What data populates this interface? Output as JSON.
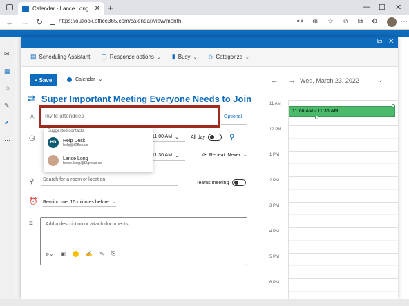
{
  "browser": {
    "tab_title": "Calendar - Lance Long - Outlook",
    "tab_close": "✕",
    "new_tab": "+",
    "url": "https://outlook.office365.com/calendar/view/month"
  },
  "toolbar": {
    "scheduling_assistant": "Scheduling Assistant",
    "response_options": "Response options",
    "busy": "Busy",
    "categorize": "Categorize",
    "more": "···"
  },
  "form": {
    "save_label": "Save",
    "calendar_label": "Calendar",
    "title": "Super Important Meeting Everyone Needs to Join",
    "attendees_placeholder": "Invite attendees",
    "optional_label": "Optional",
    "start_time": "11:00 AM",
    "end_time": "11:30 AM",
    "all_day_label": "All day",
    "repeat_label": "Repeat: Never",
    "location_placeholder": "Search for a room or location",
    "teams_label": "Teams meeting",
    "reminder_label": "Remind me: 15 minutes before",
    "description_placeholder": "Add a description or attach documents"
  },
  "suggestions": {
    "heading": "Suggested contacts",
    "contacts": [
      {
        "initials": "HD",
        "name": "Help Desk",
        "email": "help@t2flex.us"
      },
      {
        "initials": "",
        "name": "Lance Long",
        "email": "lance.long@t2group.us"
      }
    ]
  },
  "day_view": {
    "date": "Wed, March 23, 2022",
    "hours": [
      "11 AM",
      "12 PM",
      "1 PM",
      "2 PM",
      "3 PM",
      "4 PM",
      "5 PM",
      "6 PM"
    ],
    "event_label": "11:00 AM - 11:30 AM",
    "event_color": "#4cba6a"
  },
  "colors": {
    "accent": "#0f6cbd",
    "highlight_border": "#a22b1f"
  }
}
